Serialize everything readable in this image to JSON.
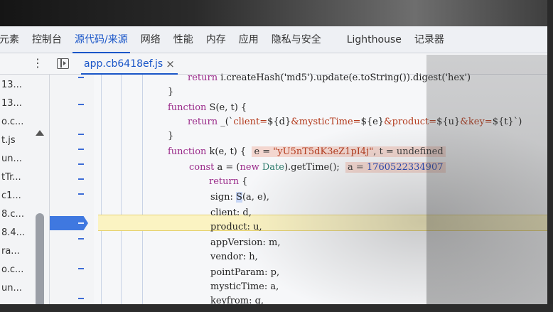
{
  "main_tabs": [
    {
      "label": "元素"
    },
    {
      "label": "控制台"
    },
    {
      "label": "源代码/来源"
    },
    {
      "label": "网络"
    },
    {
      "label": "性能"
    },
    {
      "label": "内存"
    },
    {
      "label": "应用"
    },
    {
      "label": "隐私与安全"
    },
    {
      "label": "Lighthouse"
    },
    {
      "label": "记录器"
    }
  ],
  "active_tab": "源代码/来源",
  "file_tab": {
    "name": "app.cb6418ef.js",
    "close": "×"
  },
  "navigator_items": [
    "13...",
    "13...",
    "o.c...",
    "t.js",
    "un...",
    "tTr...",
    "c1...",
    "8.c...",
    "8.4...",
    "ra...",
    "o.c...",
    "un..."
  ],
  "gutter_marker": "–",
  "code": {
    "line1": {
      "kw": "return",
      "rest": " i.createHash('md5').update(e.toString()).digest('hex')"
    },
    "line2": "}",
    "line3": {
      "kw": "function",
      "rest": " S(e, t) {"
    },
    "line4": {
      "kw": "return",
      "pre": " _(`",
      "s1": "client=",
      "v1": "${d}",
      "s2": "&mysticTime=",
      "v2": "${e}",
      "s3": "&product=",
      "v3": "${u}",
      "s4": "&key=",
      "v4": "${t}",
      "post": "`)"
    },
    "line5": "}",
    "line6": {
      "kw": "function",
      "rest": " k(e, t) {",
      "eval_pre": "e = ",
      "eval_str": "\"yU5nT5dK3eZ1pI4j\"",
      "eval_post": ", t = undefined"
    },
    "line7": {
      "kw": "const",
      "pre": " a = (",
      "kw2": "new",
      "cls": " Date",
      "post": ").getTime();",
      "eval_pre": "a = ",
      "eval_num": "1760522334907"
    },
    "line8": {
      "kw": "return",
      "rest": " {"
    },
    "line9": {
      "key": "sign: ",
      "fn": "S",
      "rest": "(a, e),"
    },
    "line10": "client: d,",
    "line11": "product: u,",
    "line12": "appVersion: m,",
    "line13": "vendor: h,",
    "line14": "pointParam: p,",
    "line15": "mysticTime: a,",
    "line16": "keyfrom: g,"
  },
  "colors": {
    "accent": "#1a56c8",
    "breakpoint": "#3f78e0",
    "exec_line": "#fbf3c2"
  }
}
